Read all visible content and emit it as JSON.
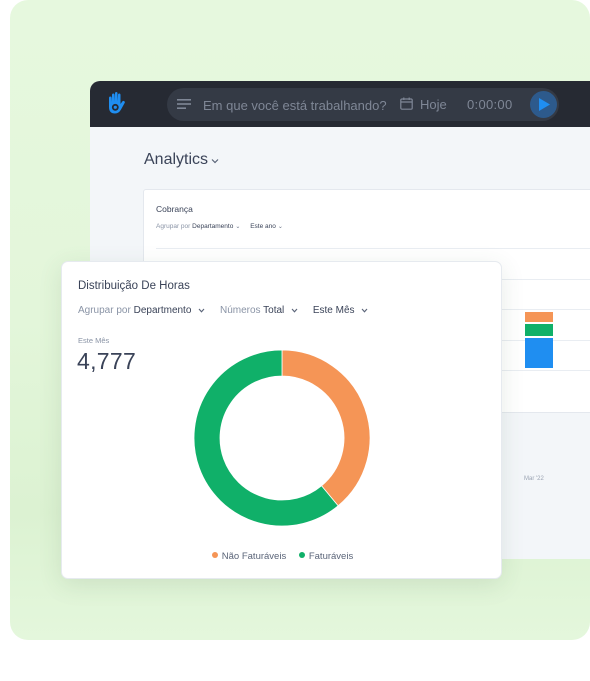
{
  "topbar": {
    "logo": "hand-logo-icon",
    "menu_icon": "menu-lines-icon",
    "task_placeholder": "Em que você está trabalhando?",
    "calendar_icon": "calendar-icon",
    "date_label": "Hoje",
    "timer": "0:00:00",
    "play_icon": "play-icon"
  },
  "page": {
    "title": "Analytics",
    "title_chevron": "chevron-down-icon"
  },
  "billing_card": {
    "title": "Cobrança",
    "group_by_label": "Agrupar por",
    "group_by_value": "Departamento",
    "period_value": "Este ano",
    "chart_data": {
      "type": "bar",
      "stacked": true,
      "categories": [
        "Mar '22"
      ],
      "series": [
        {
          "name": "segment-blue",
          "color": "#1f8ef1",
          "values": [
            0.55
          ]
        },
        {
          "name": "segment-green",
          "color": "#10b069",
          "values": [
            0.25
          ]
        },
        {
          "name": "segment-orange",
          "color": "#f59556",
          "values": [
            0.2
          ]
        }
      ]
    }
  },
  "hours_card": {
    "title": "Distribuição De Horas",
    "filters": [
      {
        "label": "Agrupar por",
        "value": "Departmento"
      },
      {
        "label": "Números",
        "value": "Total"
      },
      {
        "label": "",
        "value": "Este Mês"
      }
    ],
    "period_label": "Este Mês",
    "total": "4,777",
    "legend": [
      {
        "label": "Não Faturáveis",
        "color": "#f59556"
      },
      {
        "label": "Faturáveis",
        "color": "#10b069"
      }
    ]
  },
  "chart_data": {
    "type": "pie",
    "title": "Distribuição De Horas",
    "donut": true,
    "categories": [
      "Não Faturáveis",
      "Faturáveis"
    ],
    "values": [
      39,
      61
    ],
    "unit": "percent",
    "colors": [
      "#f59556",
      "#10b069"
    ],
    "legend_position": "bottom"
  }
}
